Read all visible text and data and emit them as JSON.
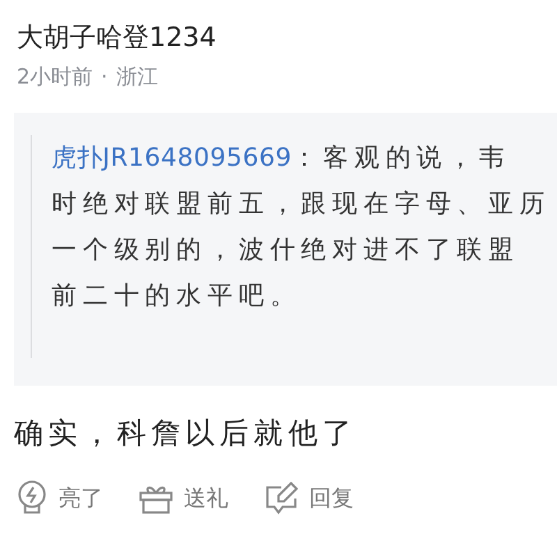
{
  "comment": {
    "username": "大胡子哈登1234",
    "time": "2小时前",
    "location": "浙江",
    "separator": "·",
    "quote": {
      "author": "虎扑JR1648095669",
      "colon": "：",
      "lines": [
        "客观的说，韦",
        "时绝对联盟前五，跟现在字母、亚历",
        "一个级别的，波什绝对进不了联盟",
        "前二十的水平吧。"
      ]
    },
    "text": "确实，科詹以后就他了",
    "actions": [
      {
        "kind": "light",
        "label": "亮了"
      },
      {
        "kind": "gift",
        "label": "送礼"
      },
      {
        "kind": "reply",
        "label": "回复"
      }
    ]
  }
}
